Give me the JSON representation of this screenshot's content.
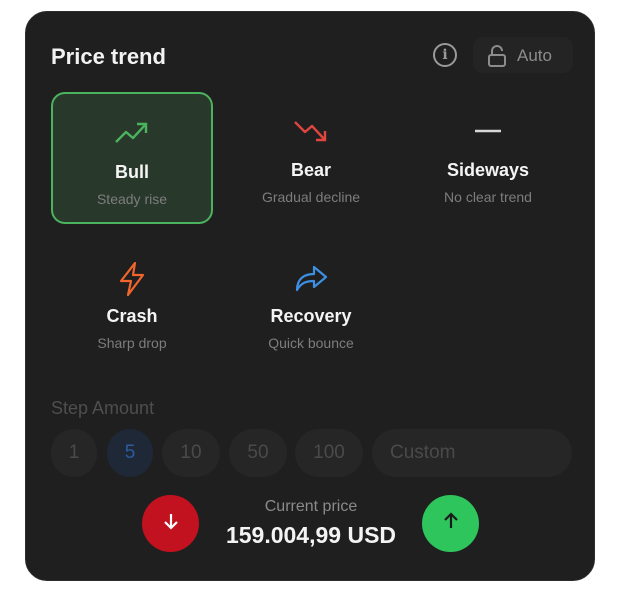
{
  "header": {
    "title": "Price trend",
    "auto_label": "Auto",
    "info_icon": "info-icon",
    "lock_icon": "lock-open-icon"
  },
  "trends": [
    {
      "name": "Bull",
      "desc": "Steady rise",
      "icon": "trending-up-icon",
      "color": "#4bb25d",
      "selected": true
    },
    {
      "name": "Bear",
      "desc": "Gradual decline",
      "icon": "trending-down-icon",
      "color": "#e0463e",
      "selected": false
    },
    {
      "name": "Sideways",
      "desc": "No clear trend",
      "icon": "flat-line-icon",
      "color": "#d8d8d8",
      "selected": false
    },
    {
      "name": "Crash",
      "desc": "Sharp drop",
      "icon": "lightning-icon",
      "color": "#f0652c",
      "selected": false
    },
    {
      "name": "Recovery",
      "desc": "Quick bounce",
      "icon": "share-arrow-icon",
      "color": "#3c8fe2",
      "selected": false
    }
  ],
  "step": {
    "label": "Step Amount",
    "options": [
      "1",
      "5",
      "10",
      "50",
      "100"
    ],
    "selected": "5",
    "custom_placeholder": "Custom"
  },
  "price": {
    "label": "Current price",
    "value": "159.004,99 USD",
    "down_icon": "arrow-down-icon",
    "up_icon": "arrow-up-icon"
  },
  "colors": {
    "panel_bg": "#1f1f1f",
    "selected_border": "#4bb25d",
    "down_button": "#c3121f",
    "up_button": "#2ec55c",
    "active_chip_text": "#2b5c9e"
  }
}
